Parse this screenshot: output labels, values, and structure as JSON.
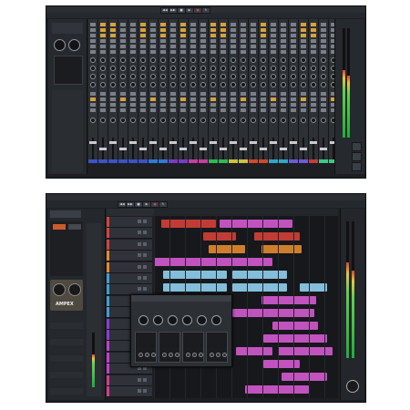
{
  "mixer_window": {
    "transport_icons": [
      "rewind-icon",
      "forward-icon",
      "stop-icon",
      "play-icon",
      "record-icon",
      "loop-icon"
    ],
    "channels": [
      {
        "name": "",
        "color": "#3b52c8"
      },
      {
        "name": "",
        "color": "#3b52c8"
      },
      {
        "name": "",
        "color": "#3b52c8"
      },
      {
        "name": "",
        "color": "#3b52c8"
      },
      {
        "name": "",
        "color": "#3b52c8"
      },
      {
        "name": "",
        "color": "#3b52c8"
      },
      {
        "name": "",
        "color": "#2e7bd6"
      },
      {
        "name": "",
        "color": "#2e7bd6"
      },
      {
        "name": "",
        "color": "#7a3cc8"
      },
      {
        "name": "",
        "color": "#7a3cc8"
      },
      {
        "name": "",
        "color": "#c83ca4"
      },
      {
        "name": "",
        "color": "#c83ca4"
      },
      {
        "name": "",
        "color": "#2cba52"
      },
      {
        "name": "",
        "color": "#2cba52"
      },
      {
        "name": "",
        "color": "#c8c23c"
      },
      {
        "name": "",
        "color": "#c8c23c"
      },
      {
        "name": "",
        "color": "#cc4b2a"
      },
      {
        "name": "",
        "color": "#cc4b2a"
      },
      {
        "name": "",
        "color": "#2ca8c8"
      },
      {
        "name": "",
        "color": "#2ca8c8"
      },
      {
        "name": "",
        "color": "#6d5ad8"
      },
      {
        "name": "",
        "color": "#6d5ad8"
      },
      {
        "name": "",
        "color": "#c83c3c"
      },
      {
        "name": "",
        "color": "#3cc88a"
      },
      {
        "name": "",
        "color": "#3cc88a"
      }
    ],
    "master_meter_level": 0.62
  },
  "arrange_window": {
    "title": "",
    "plugin_title": "",
    "plugin_label": "",
    "left_zone_label": "AMPEX",
    "tracks": [
      {
        "name": "",
        "color": "#d4443c"
      },
      {
        "name": "",
        "color": "#d4443c"
      },
      {
        "name": "",
        "color": "#d4443c"
      },
      {
        "name": "",
        "color": "#e6892e"
      },
      {
        "name": "",
        "color": "#e6892e"
      },
      {
        "name": "",
        "color": "#3ca0d4"
      },
      {
        "name": "",
        "color": "#3ca0d4"
      },
      {
        "name": "",
        "color": "#3ca0d4"
      },
      {
        "name": "",
        "color": "#3ca0d4"
      },
      {
        "name": "",
        "color": "#8b3cd4"
      },
      {
        "name": "",
        "color": "#8b3cd4"
      },
      {
        "name": "",
        "color": "#c43cd4"
      },
      {
        "name": "",
        "color": "#c43cd4"
      },
      {
        "name": "",
        "color": "#c43cd4"
      },
      {
        "name": "",
        "color": "#d43c8f"
      },
      {
        "name": "",
        "color": "#d43c8f"
      }
    ],
    "meter_levels": [
      0.7,
      0.64
    ],
    "accent_colors": {
      "audio": "#8fd0f0",
      "midi": "#d45ad0",
      "orange": "#e38a2e",
      "red": "#d44038"
    }
  }
}
